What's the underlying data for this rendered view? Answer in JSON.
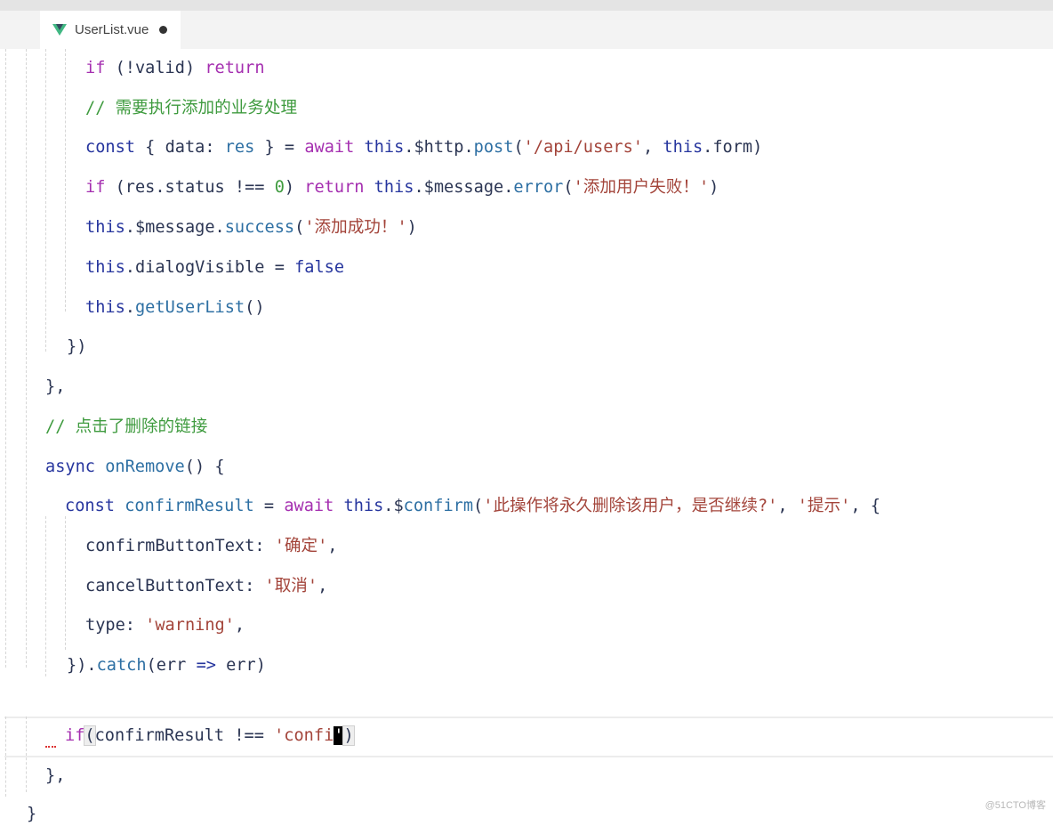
{
  "tab": {
    "file_name": "UserList.vue",
    "icon": "vue-icon",
    "modified": true
  },
  "code": [
    [
      [
        "if",
        "kw"
      ],
      [
        " (!valid) ",
        "pl"
      ],
      [
        "return",
        "kw"
      ]
    ],
    [
      [
        "// 需要执行添加的业务处理",
        "cmt"
      ]
    ],
    [
      [
        "const",
        "this"
      ],
      [
        " { data: ",
        "pl"
      ],
      [
        "res",
        "fn"
      ],
      [
        " } = ",
        "pl"
      ],
      [
        "await",
        "kw"
      ],
      [
        " ",
        "pl"
      ],
      [
        "this",
        "this"
      ],
      [
        ".$http.",
        "pl"
      ],
      [
        "post",
        "fn"
      ],
      [
        "(",
        "pl"
      ],
      [
        "'/api/users'",
        "str"
      ],
      [
        ", ",
        "pl"
      ],
      [
        "this",
        "this"
      ],
      [
        ".form)",
        "pl"
      ]
    ],
    [
      [
        "if",
        "kw"
      ],
      [
        " (res.status !== ",
        "pl"
      ],
      [
        "0",
        "num"
      ],
      [
        ") ",
        "pl"
      ],
      [
        "return",
        "kw"
      ],
      [
        " ",
        "pl"
      ],
      [
        "this",
        "this"
      ],
      [
        ".$message.",
        "pl"
      ],
      [
        "error",
        "fn"
      ],
      [
        "(",
        "pl"
      ],
      [
        "'添加用户失败！'",
        "str"
      ],
      [
        ")",
        "pl"
      ]
    ],
    [
      [
        "this",
        "this"
      ],
      [
        ".$message.",
        "pl"
      ],
      [
        "success",
        "fn"
      ],
      [
        "(",
        "pl"
      ],
      [
        "'添加成功！'",
        "str"
      ],
      [
        ")",
        "pl"
      ]
    ],
    [
      [
        "this",
        "this"
      ],
      [
        ".dialogVisible = ",
        "pl"
      ],
      [
        "false",
        "this"
      ]
    ],
    [
      [
        "this",
        "this"
      ],
      [
        ".",
        "pl"
      ],
      [
        "getUserList",
        "fn"
      ],
      [
        "()",
        "pl"
      ]
    ],
    [
      [
        "})",
        "pl"
      ]
    ],
    [
      [
        "},",
        "pl"
      ]
    ],
    [
      [
        "// 点击了删除的链接",
        "cmt"
      ]
    ],
    [
      [
        "async",
        "this"
      ],
      [
        " ",
        "pl"
      ],
      [
        "onRemove",
        "fn"
      ],
      [
        "() {",
        "pl"
      ]
    ],
    [
      [
        "const",
        "this"
      ],
      [
        " ",
        "pl"
      ],
      [
        "confirmResult",
        "fn"
      ],
      [
        " = ",
        "pl"
      ],
      [
        "await",
        "kw"
      ],
      [
        " ",
        "pl"
      ],
      [
        "this",
        "this"
      ],
      [
        ".$",
        "pl"
      ],
      [
        "confirm",
        "fn"
      ],
      [
        "(",
        "pl"
      ],
      [
        "'此操作将永久删除该用户，是否继续?'",
        "str"
      ],
      [
        ", ",
        "pl"
      ],
      [
        "'提示'",
        "str"
      ],
      [
        ", {",
        "pl"
      ]
    ],
    [
      [
        "confirmButtonText",
        "pl"
      ],
      [
        ": ",
        "pl"
      ],
      [
        "'确定'",
        "str"
      ],
      [
        ",",
        "pl"
      ]
    ],
    [
      [
        "cancelButtonText",
        "pl"
      ],
      [
        ": ",
        "pl"
      ],
      [
        "'取消'",
        "str"
      ],
      [
        ",",
        "pl"
      ]
    ],
    [
      [
        "type",
        "pl"
      ],
      [
        ": ",
        "pl"
      ],
      [
        "'warning'",
        "str"
      ],
      [
        ",",
        "pl"
      ]
    ],
    [
      [
        "}).",
        "pl"
      ],
      [
        "catch",
        "fn"
      ],
      [
        "(err ",
        "pl"
      ],
      [
        "=>",
        "this"
      ],
      [
        " err)",
        "pl"
      ]
    ],
    [
      [
        "if",
        "kw"
      ],
      [
        "(",
        "bracket"
      ],
      [
        "confirmResult !== ",
        "pl"
      ],
      [
        "'confi",
        "str"
      ],
      [
        "'",
        "cursor"
      ],
      [
        ")",
        "bracket"
      ]
    ],
    [
      [
        "},",
        "pl"
      ]
    ],
    [
      [
        "}",
        "pl"
      ]
    ]
  ],
  "watermark": "@51CTO博客"
}
